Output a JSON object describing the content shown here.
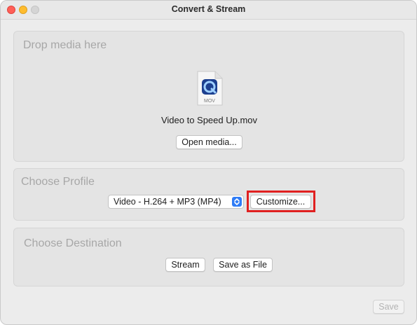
{
  "window": {
    "title": "Convert & Stream"
  },
  "drop_panel": {
    "title": "Drop media here",
    "file_icon_label": "MOV",
    "file_name": "Video to Speed Up.mov",
    "open_media_label": "Open media..."
  },
  "profile_panel": {
    "title": "Choose Profile",
    "selected_profile": "Video - H.264 + MP3 (MP4)",
    "customize_label": "Customize..."
  },
  "destination_panel": {
    "title": "Choose Destination",
    "stream_label": "Stream",
    "save_as_file_label": "Save as File"
  },
  "footer": {
    "save_label": "Save"
  },
  "colors": {
    "highlight": "#e02020",
    "select_accent": "#2f7cf6"
  }
}
